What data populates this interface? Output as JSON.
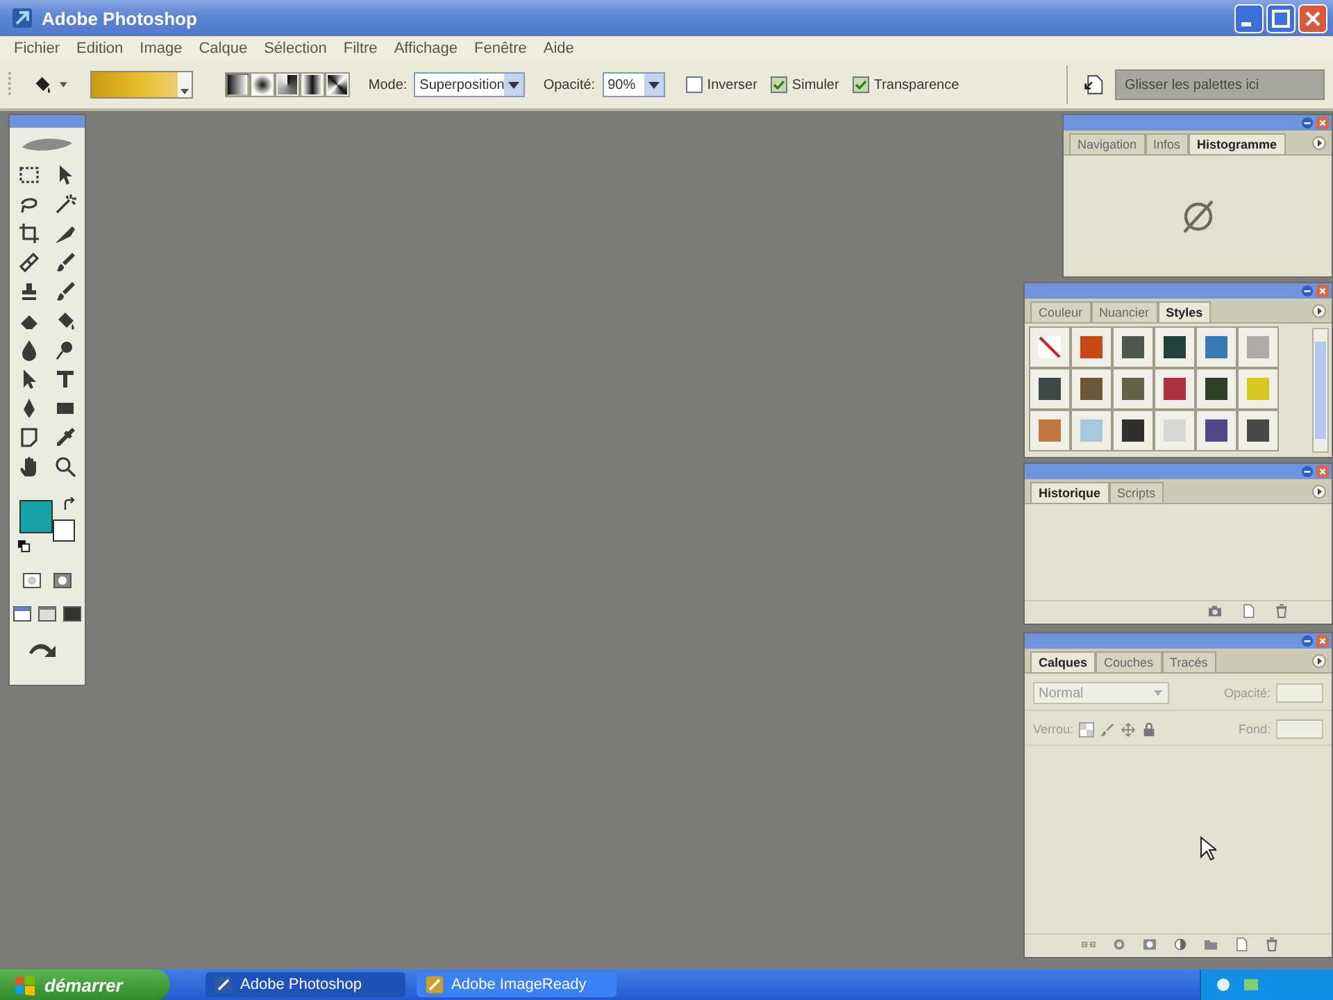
{
  "window": {
    "title": "Adobe Photoshop"
  },
  "menu": [
    "Fichier",
    "Edition",
    "Image",
    "Calque",
    "Sélection",
    "Filtre",
    "Affichage",
    "Fenêtre",
    "Aide"
  ],
  "options_bar": {
    "gradient_types": [
      {
        "kind": "linear",
        "selected": true
      },
      {
        "kind": "radial",
        "selected": false
      },
      {
        "kind": "angle",
        "selected": false
      },
      {
        "kind": "reflected",
        "selected": false
      },
      {
        "kind": "diamond",
        "selected": false
      }
    ],
    "mode": {
      "label": "Mode:",
      "value": "Superposition"
    },
    "opacity": {
      "label": "Opacité:",
      "value": "90%"
    },
    "checkboxes": [
      {
        "label": "Inverser",
        "checked": false
      },
      {
        "label": "Simuler",
        "checked": true
      },
      {
        "label": "Transparence",
        "checked": true
      }
    ],
    "palette_well": "Glisser les palettes ici"
  },
  "toolbox": {
    "color_swatches": [
      {
        "kind": "foreground",
        "color": "#17a2a6"
      },
      {
        "kind": "background",
        "color": "#ffffff"
      }
    ]
  },
  "palettes": [
    {
      "kind": "histogram",
      "tabs": [
        {
          "label": "Navigation",
          "selected": false
        },
        {
          "label": "Infos",
          "selected": false
        },
        {
          "label": "Histogramme",
          "selected": true
        }
      ]
    },
    {
      "kind": "styles",
      "tabs": [
        {
          "label": "Couleur",
          "selected": false
        },
        {
          "label": "Nuancier",
          "selected": false
        },
        {
          "label": "Styles",
          "selected": true
        }
      ],
      "styles": [
        {
          "kind": "none"
        },
        {
          "kind": "swatch",
          "color": "#c84818"
        },
        {
          "kind": "swatch",
          "color": "#4e5850"
        },
        {
          "kind": "swatch",
          "color": "#24403a"
        },
        {
          "kind": "swatch",
          "color": "#3878b8"
        },
        {
          "kind": "swatch",
          "color": "#b0a8a8"
        },
        {
          "kind": "swatch",
          "color": "#3c4846"
        },
        {
          "kind": "swatch",
          "color": "#6a5838"
        },
        {
          "kind": "swatch",
          "color": "#646448"
        },
        {
          "kind": "swatch",
          "color": "#b03040"
        },
        {
          "kind": "swatch",
          "color": "#304028"
        },
        {
          "kind": "swatch",
          "color": "#d8c820"
        },
        {
          "kind": "swatch",
          "color": "#c07840"
        },
        {
          "kind": "swatch",
          "color": "#a8c8e0"
        },
        {
          "kind": "swatch",
          "color": "#303030"
        },
        {
          "kind": "swatch",
          "color": "#d8d8d8"
        },
        {
          "kind": "swatch",
          "color": "#504888"
        },
        {
          "kind": "swatch",
          "color": "#484848"
        }
      ]
    },
    {
      "kind": "history",
      "tabs": [
        {
          "label": "Historique",
          "selected": true
        },
        {
          "label": "Scripts",
          "selected": false
        }
      ]
    },
    {
      "kind": "layers",
      "tabs": [
        {
          "label": "Calques",
          "selected": true
        },
        {
          "label": "Couches",
          "selected": false
        },
        {
          "label": "Tracés",
          "selected": false
        }
      ],
      "blend_mode": "Normal",
      "opacity_label": "Opacité:",
      "lock_label": "Verrou:",
      "fill_label": "Fond:"
    }
  ],
  "taskbar": {
    "start": "démarrer",
    "tasks": [
      {
        "label": "Adobe Photoshop",
        "selected": true
      },
      {
        "label": "Adobe ImageReady",
        "selected": false
      }
    ]
  }
}
